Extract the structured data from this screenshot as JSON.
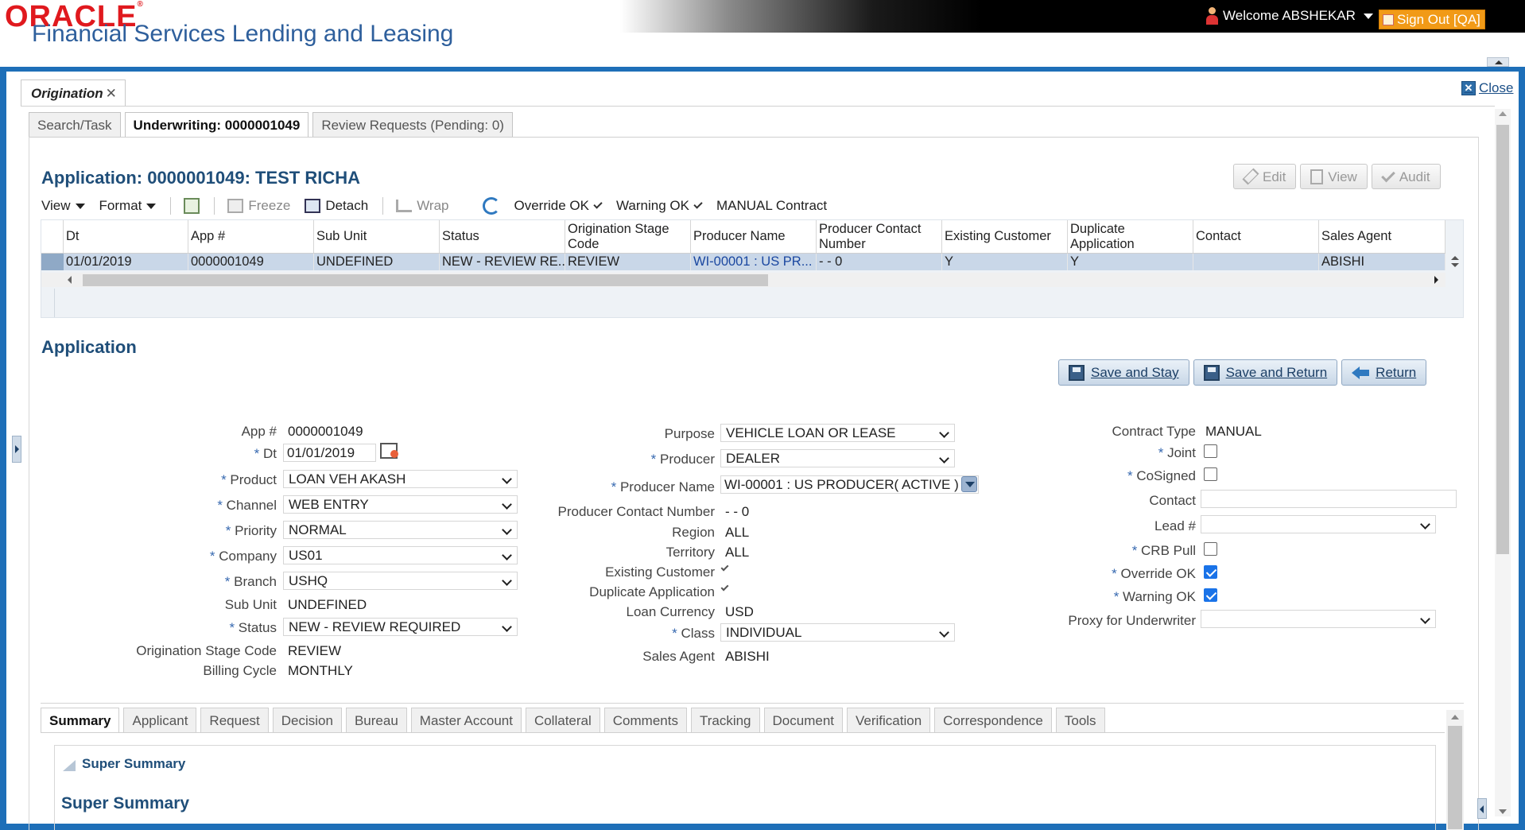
{
  "brand": {
    "logo": "ORACLE",
    "product": "Financial Services Lending and Leasing"
  },
  "header": {
    "welcome": "Welcome ABSHEKAR",
    "signout": "Sign Out [QA]"
  },
  "window": {
    "tab": "Origination",
    "close": "Close"
  },
  "subtabs": [
    "Search/Task",
    "Underwriting: 0000001049",
    "Review Requests (Pending: 0)"
  ],
  "app_title": "Application: 0000001049: TEST RICHA",
  "right_buttons": {
    "edit": "Edit",
    "view": "View",
    "audit": "Audit"
  },
  "toolbar": {
    "view": "View",
    "format": "Format",
    "freeze": "Freeze",
    "detach": "Detach",
    "wrap": "Wrap",
    "override_ok": "Override OK",
    "warning_ok": "Warning OK",
    "manual_contract": "MANUAL Contract"
  },
  "grid": {
    "headers": [
      "Dt",
      "App #",
      "Sub Unit",
      "Status",
      "Origination Stage Code",
      "Producer Name",
      "Producer Contact Number",
      "Existing Customer",
      "Duplicate Application",
      "Contact",
      "Sales Agent"
    ],
    "row": [
      "01/01/2019",
      "0000001049",
      "UNDEFINED",
      "NEW - REVIEW RE...",
      "REVIEW",
      "WI-00001 : US PR...",
      "- - 0",
      "Y",
      "Y",
      "",
      "ABISHI"
    ]
  },
  "section_title": "Application",
  "actions": {
    "save_stay": "Save and Stay",
    "save_return": "Save and Return",
    "return": "Return"
  },
  "form": {
    "col1": {
      "app_no_label": "App #",
      "app_no": "0000001049",
      "dt_label": "Dt",
      "dt": "01/01/2019",
      "product_label": "Product",
      "product": "LOAN VEH AKASH",
      "channel_label": "Channel",
      "channel": "WEB ENTRY",
      "priority_label": "Priority",
      "priority": "NORMAL",
      "company_label": "Company",
      "company": "US01",
      "branch_label": "Branch",
      "branch": "USHQ",
      "subunit_label": "Sub Unit",
      "subunit": "UNDEFINED",
      "status_label": "Status",
      "status": "NEW - REVIEW REQUIRED",
      "stage_label": "Origination Stage Code",
      "stage": "REVIEW",
      "billing_label": "Billing Cycle",
      "billing": "MONTHLY"
    },
    "col2": {
      "purpose_label": "Purpose",
      "purpose": "VEHICLE LOAN OR LEASE",
      "producer_label": "Producer",
      "producer": "DEALER",
      "producer_name_label": "Producer Name",
      "producer_name": "WI-00001 : US PRODUCER( ACTIVE )",
      "pcn_label": "Producer Contact Number",
      "pcn": "- - 0",
      "region_label": "Region",
      "region": "ALL",
      "territory_label": "Territory",
      "territory": "ALL",
      "existing_label": "Existing Customer",
      "duplicate_label": "Duplicate Application",
      "currency_label": "Loan Currency",
      "currency": "USD",
      "class_label": "Class",
      "class": "INDIVIDUAL",
      "agent_label": "Sales Agent",
      "agent": "ABISHI"
    },
    "col3": {
      "contract_type_label": "Contract Type",
      "contract_type": "MANUAL",
      "joint_label": "Joint",
      "joint": false,
      "cosigned_label": "CoSigned",
      "cosigned": false,
      "contact_label": "Contact",
      "contact": "",
      "lead_label": "Lead #",
      "lead": "",
      "crb_label": "CRB Pull",
      "crb": false,
      "override_label": "Override OK",
      "override": true,
      "warning_label": "Warning OK",
      "warning": true,
      "proxy_label": "Proxy for Underwriter",
      "proxy": ""
    }
  },
  "bottom_tabs": [
    "Summary",
    "Applicant",
    "Request",
    "Decision",
    "Bureau",
    "Master Account",
    "Collateral",
    "Comments",
    "Tracking",
    "Document",
    "Verification",
    "Correspondence",
    "Tools"
  ],
  "super_summary": {
    "panel": "Super Summary",
    "title": "Super Summary"
  }
}
